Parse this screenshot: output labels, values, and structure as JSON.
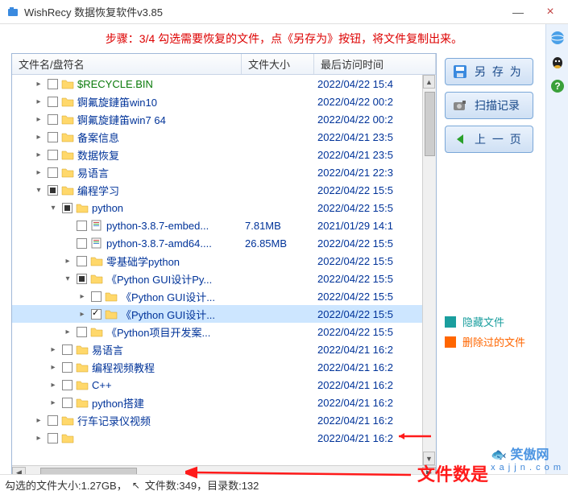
{
  "window": {
    "title": "WishRecy 数据恢复软件v3.85",
    "min": "—",
    "close": "×"
  },
  "step_banner": "步骤：3/4 勾选需要恢复的文件，点《另存为》按钮，将文件复制出来。",
  "columns": {
    "name": "文件名/盘符名",
    "size": "文件大小",
    "date": "最后访问时间"
  },
  "rows": [
    {
      "indent": 1,
      "exp": "▸",
      "chk": "",
      "icon": "folder",
      "name": "$RECYCLE.BIN",
      "size": "",
      "date": "2022/04/22 15:4",
      "green": true
    },
    {
      "indent": 1,
      "exp": "▸",
      "chk": "",
      "icon": "folder",
      "name": "锕氟旋鏈笛win10",
      "size": "",
      "date": "2022/04/22 00:2"
    },
    {
      "indent": 1,
      "exp": "▸",
      "chk": "",
      "icon": "folder",
      "name": "锕氟旋鏈笛win7 64",
      "size": "",
      "date": "2022/04/22 00:2"
    },
    {
      "indent": 1,
      "exp": "▸",
      "chk": "",
      "icon": "folder",
      "name": "备案信息",
      "size": "",
      "date": "2022/04/21 23:5"
    },
    {
      "indent": 1,
      "exp": "▸",
      "chk": "",
      "icon": "folder",
      "name": "数据恢复",
      "size": "",
      "date": "2022/04/21 23:5"
    },
    {
      "indent": 1,
      "exp": "▸",
      "chk": "",
      "icon": "folder",
      "name": "易语言",
      "size": "",
      "date": "2022/04/21 22:3"
    },
    {
      "indent": 1,
      "exp": "▾",
      "chk": "partial",
      "icon": "folder",
      "name": "编程学习",
      "size": "",
      "date": "2022/04/22 15:5"
    },
    {
      "indent": 2,
      "exp": "▾",
      "chk": "partial",
      "icon": "folder",
      "name": "python",
      "size": "",
      "date": "2022/04/22 15:5"
    },
    {
      "indent": 3,
      "exp": "",
      "chk": "",
      "icon": "file",
      "name": "python-3.8.7-embed...",
      "size": "7.81MB",
      "date": "2021/01/29 14:1"
    },
    {
      "indent": 3,
      "exp": "",
      "chk": "",
      "icon": "file",
      "name": "python-3.8.7-amd64....",
      "size": "26.85MB",
      "date": "2022/04/22 15:5"
    },
    {
      "indent": 3,
      "exp": "▸",
      "chk": "",
      "icon": "folder",
      "name": "零基础学python",
      "size": "",
      "date": "2022/04/22 15:5"
    },
    {
      "indent": 3,
      "exp": "▾",
      "chk": "partial",
      "icon": "folder",
      "name": "《Python GUI设计Py...",
      "size": "",
      "date": "2022/04/22 15:5"
    },
    {
      "indent": 4,
      "exp": "▸",
      "chk": "",
      "icon": "folder",
      "name": "《Python GUI设计...",
      "size": "",
      "date": "2022/04/22 15:5"
    },
    {
      "indent": 4,
      "exp": "▸",
      "chk": "checked",
      "icon": "folder",
      "name": "《Python GUI设计...",
      "size": "",
      "date": "2022/04/22 15:5",
      "selected": true
    },
    {
      "indent": 3,
      "exp": "▸",
      "chk": "",
      "icon": "folder",
      "name": "《Python项目开发案...",
      "size": "",
      "date": "2022/04/22 15:5"
    },
    {
      "indent": 2,
      "exp": "▸",
      "chk": "",
      "icon": "folder",
      "name": "易语言",
      "size": "",
      "date": "2022/04/21 16:2"
    },
    {
      "indent": 2,
      "exp": "▸",
      "chk": "",
      "icon": "folder",
      "name": "编程视频教程",
      "size": "",
      "date": "2022/04/21 16:2"
    },
    {
      "indent": 2,
      "exp": "▸",
      "chk": "",
      "icon": "folder",
      "name": "C++",
      "size": "",
      "date": "2022/04/21 16:2"
    },
    {
      "indent": 2,
      "exp": "▸",
      "chk": "",
      "icon": "folder",
      "name": "python搭建",
      "size": "",
      "date": "2022/04/21 16:2"
    },
    {
      "indent": 1,
      "exp": "▸",
      "chk": "",
      "icon": "folder",
      "name": "行车记录仪视频",
      "size": "",
      "date": "2022/04/21 16:2"
    },
    {
      "indent": 1,
      "exp": "▸",
      "chk": "",
      "icon": "folder",
      "name": "",
      "size": "",
      "date": "2022/04/21 16:2"
    }
  ],
  "buttons": {
    "save_as": "另 存 为",
    "scan_log": "扫描记录",
    "prev_page": "上 一 页"
  },
  "legend": {
    "hidden": "隐藏文件",
    "deleted": "删除过的文件"
  },
  "status": {
    "prefix": "勾选的文件大小:1.27GB，",
    "files": "文件数:349，",
    "dirs": "目录数:132"
  },
  "overlay": {
    "text": "文件数是"
  },
  "watermark": {
    "brand": "笑傲网",
    "url": "x a j j n . c o m"
  }
}
